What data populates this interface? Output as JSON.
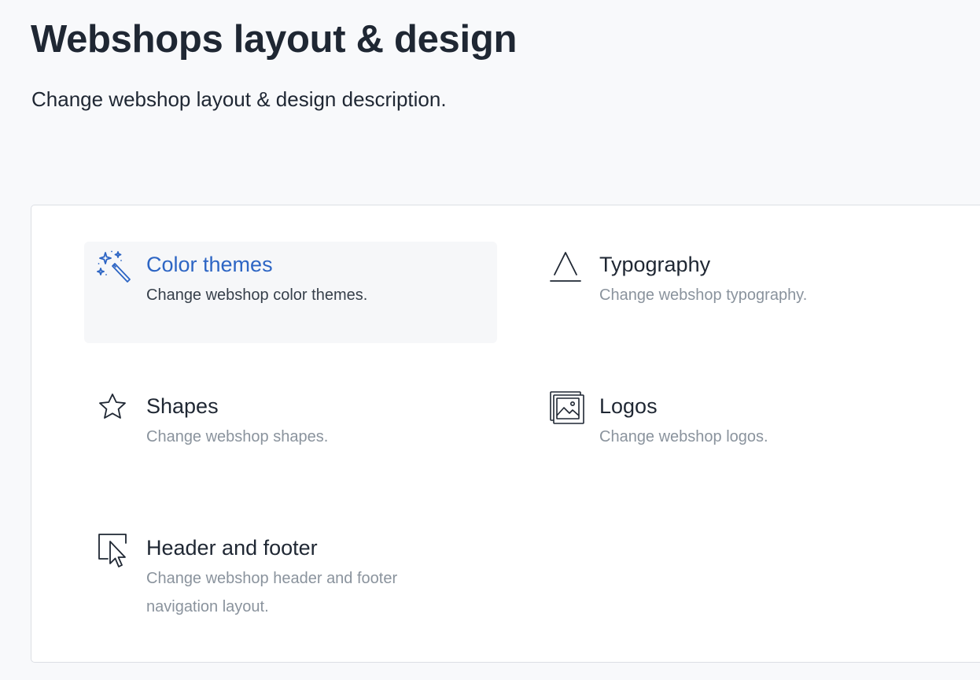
{
  "page": {
    "title": "Webshops layout & design",
    "description": "Change webshop layout & design description."
  },
  "options": [
    {
      "title": "Color themes",
      "description": "Change webshop color themes.",
      "icon": "magic-wand-icon",
      "active": true
    },
    {
      "title": "Typography",
      "description": "Change webshop typography.",
      "icon": "typography-icon",
      "active": false
    },
    {
      "title": "Shapes",
      "description": "Change webshop shapes.",
      "icon": "star-icon",
      "active": false
    },
    {
      "title": "Logos",
      "description": "Change webshop logos.",
      "icon": "image-stack-icon",
      "active": false
    },
    {
      "title": "Header and footer",
      "description": "Change webshop header and footer navigation layout.",
      "icon": "cursor-window-icon",
      "active": false
    }
  ],
  "colors": {
    "background": "#f8f9fb",
    "panel": "#ffffff",
    "accent": "#2d65c4",
    "text": "#1f2733",
    "muted": "#8a939d"
  }
}
